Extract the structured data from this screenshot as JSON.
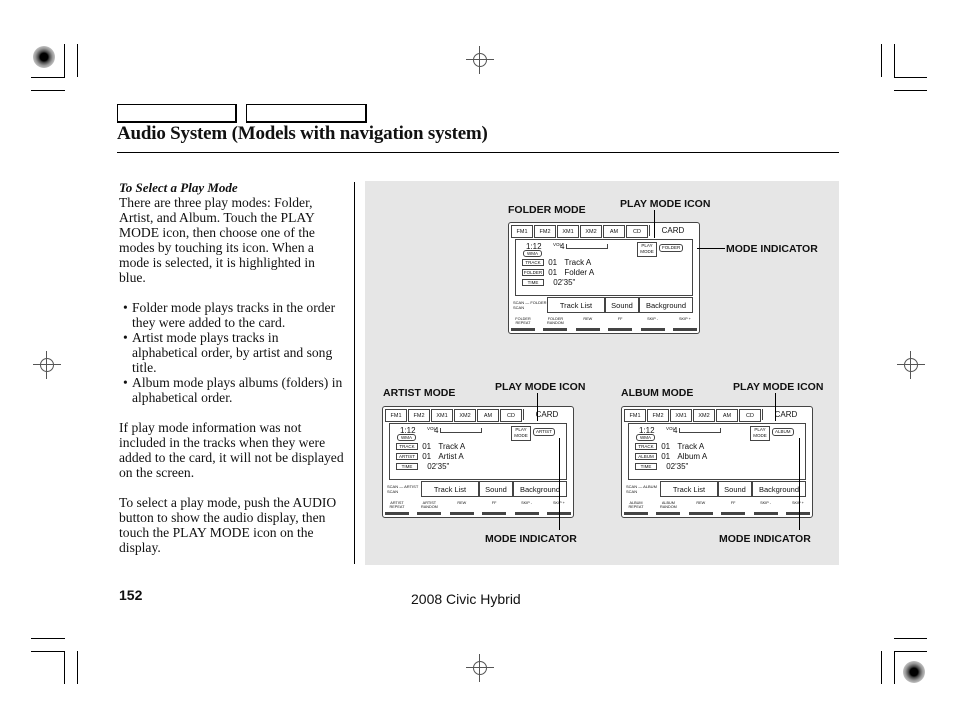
{
  "header": {
    "title": "Audio System (Models with navigation system)"
  },
  "text": {
    "subheading": "To Select a Play Mode",
    "intro": "There are three play modes: Folder, Artist, and Album. Touch the PLAY MODE icon, then choose one of the modes by touching its icon. When a mode is selected, it is highlighted in blue.",
    "bullets": [
      "Folder mode plays tracks in the order they were added to the card.",
      "Artist mode plays tracks in alphabetical order, by artist and song title.",
      "Album mode plays albums (folders) in alphabetical order."
    ],
    "para2": "If play mode information was not included in the tracks when they were added to the card, it will not be displayed on the screen.",
    "para3": "To select a play mode, push the AUDIO button to show the audio display, then touch the PLAY MODE icon on the display."
  },
  "figure": {
    "callouts": {
      "play_mode_icon": "PLAY MODE ICON",
      "mode_indicator": "MODE INDICATOR"
    },
    "screens": [
      {
        "mode_label": "FOLDER MODE",
        "tabs": [
          "FM1",
          "FM2",
          "XM1",
          "XM2",
          "AM",
          "CD",
          "CARD"
        ],
        "time": "1:12",
        "vol_label": "VOL",
        "vol": "4",
        "play_mode": "PLAY MODE",
        "indicator": "FOLDER",
        "format": "WMA",
        "rows": [
          {
            "tag": "TRACK",
            "num": "01",
            "value": "Track A"
          },
          {
            "tag": "FOLDER",
            "num": "01",
            "value": "Folder A"
          },
          {
            "tag": "TIME",
            "num": "",
            "value": "02'35\""
          }
        ],
        "scan": "SCAN — FOLDER SCAN",
        "buttons": [
          "Track List",
          "Sound",
          "Background"
        ],
        "keys": [
          "FOLDER REPEAT",
          "FOLDER RANDOM",
          "REW",
          "FF",
          "SKIP -",
          "SKIP +"
        ]
      },
      {
        "mode_label": "ARTIST MODE",
        "tabs": [
          "FM1",
          "FM2",
          "XM1",
          "XM2",
          "AM",
          "CD",
          "CARD"
        ],
        "time": "1:12",
        "vol_label": "VOL",
        "vol": "4",
        "play_mode": "PLAY MODE",
        "indicator": "ARTIST",
        "format": "WMA",
        "rows": [
          {
            "tag": "TRACK",
            "num": "01",
            "value": "Track A"
          },
          {
            "tag": "ARTIST",
            "num": "01",
            "value": "Artist A"
          },
          {
            "tag": "TIME",
            "num": "",
            "value": "02'35\""
          }
        ],
        "scan": "SCAN — ARTIST SCAN",
        "buttons": [
          "Track List",
          "Sound",
          "Background"
        ],
        "keys": [
          "ARTIST REPEAT",
          "ARTIST RANDOM",
          "REW",
          "FF",
          "SKIP -",
          "SKIP +"
        ]
      },
      {
        "mode_label": "ALBUM MODE",
        "tabs": [
          "FM1",
          "FM2",
          "XM1",
          "XM2",
          "AM",
          "CD",
          "CARD"
        ],
        "time": "1:12",
        "vol_label": "VOL",
        "vol": "4",
        "play_mode": "PLAY MODE",
        "indicator": "ALBUM",
        "format": "WMA",
        "rows": [
          {
            "tag": "TRACK",
            "num": "01",
            "value": "Track A"
          },
          {
            "tag": "ALBUM",
            "num": "01",
            "value": "Album A"
          },
          {
            "tag": "TIME",
            "num": "",
            "value": "02'35\""
          }
        ],
        "scan": "SCAN — ALBUM SCAN",
        "buttons": [
          "Track List",
          "Sound",
          "Background"
        ],
        "keys": [
          "ALBUM REPEAT",
          "ALBUM RANDOM",
          "REW",
          "FF",
          "SKIP -",
          "SKIP +"
        ]
      }
    ]
  },
  "footer": {
    "page_number": "152",
    "model": "2008  Civic  Hybrid"
  }
}
